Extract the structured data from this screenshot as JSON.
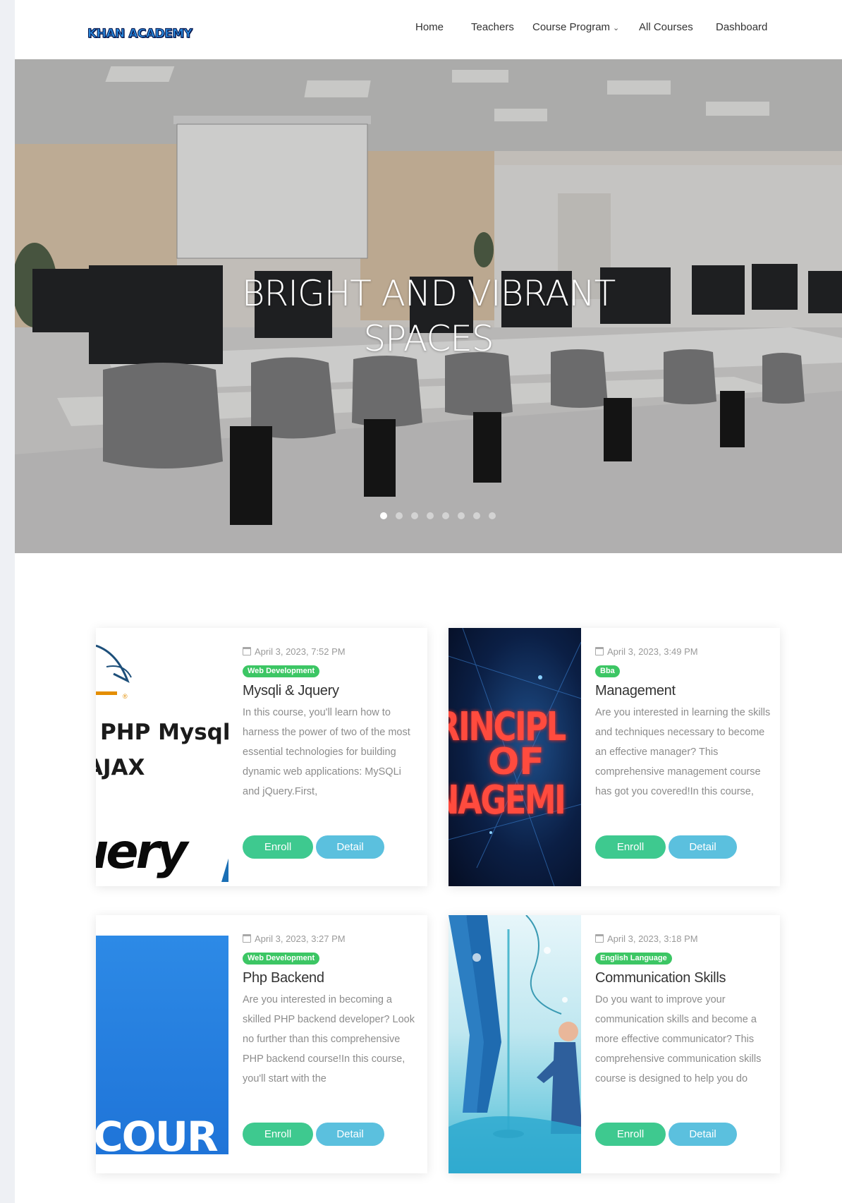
{
  "brand": {
    "logo_text": "KHAN ACADEMY"
  },
  "nav": {
    "items": [
      {
        "label": "Home"
      },
      {
        "label": "Teachers"
      },
      {
        "label": "Course Program"
      },
      {
        "label": "All Courses"
      },
      {
        "label": "Dashboard"
      }
    ]
  },
  "hero": {
    "title_line1": "BRIGHT AND VIBRANT",
    "title_line2": "SPACES",
    "slide_count": 8,
    "active_slide": 1
  },
  "courses": [
    {
      "date": "April 3, 2023, 7:52 PM",
      "category": "Web Development",
      "title": "Mysqli & Jquery",
      "description": "In this course, you'll learn how to harness the power of two of the most essential technologies for building dynamic web applications: MySQLi and jQuery.First,",
      "enroll_label": "Enroll",
      "detail_label": "Detail",
      "thumb_text": [
        "PHP Mysqli",
        "AJAX",
        "uery"
      ]
    },
    {
      "date": "April 3, 2023, 3:49 PM",
      "category": "Bba",
      "title": "Management",
      "description": "Are you interested in learning the skills and techniques necessary to become an effective manager? This comprehensive management course has got you covered!In this course,",
      "enroll_label": "Enroll",
      "detail_label": "Detail",
      "thumb_text": [
        "RINCIPL",
        "OF",
        "NAGEMI"
      ]
    },
    {
      "date": "April 3, 2023, 3:27 PM",
      "category": "Web Development",
      "title": "Php Backend",
      "description": "Are you interested in becoming a skilled PHP backend developer? Look no further than this comprehensive PHP backend course!In this course, you'll start with the",
      "enroll_label": "Enroll",
      "detail_label": "Detail",
      "thumb_text": [
        "COUR"
      ]
    },
    {
      "date": "April 3, 2023, 3:18 PM",
      "category": "English Language",
      "title": "Communication Skills",
      "description": "Do you want to improve your communication skills and become a more effective communicator? This comprehensive communication skills course is designed to help you do",
      "enroll_label": "Enroll",
      "detail_label": "Detail",
      "thumb_text": []
    }
  ],
  "colors": {
    "enroll": "#3ec98f",
    "detail": "#5bc0de",
    "badge": "#3cc664",
    "logo": "#2b8fe6"
  }
}
